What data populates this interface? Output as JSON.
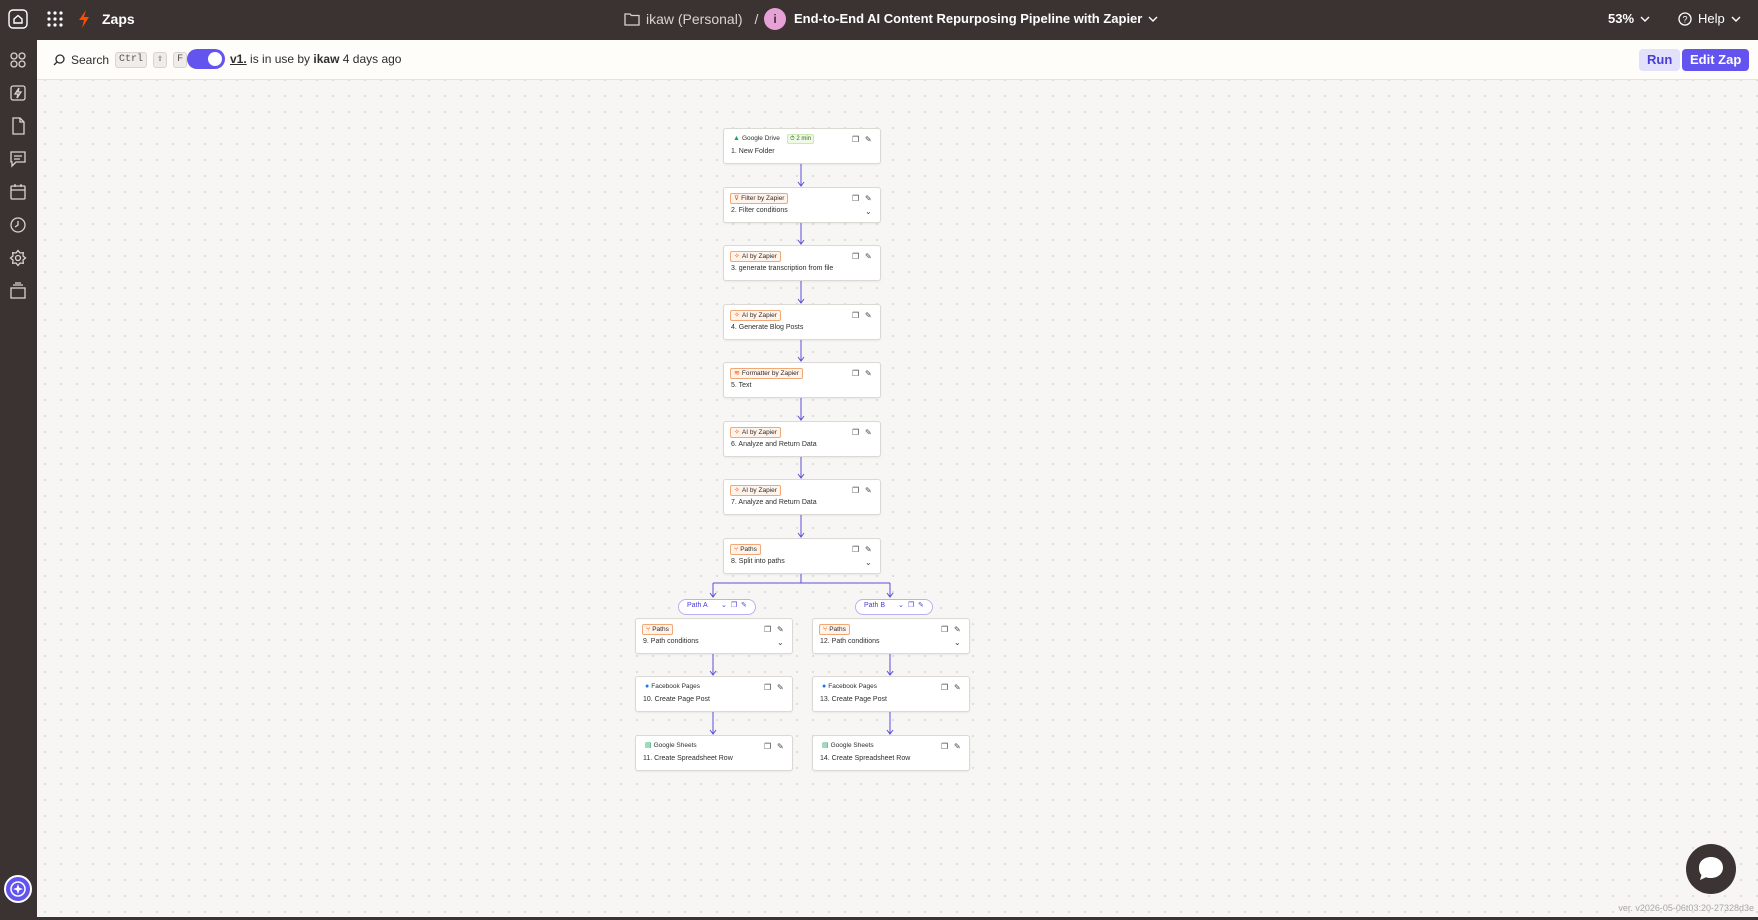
{
  "topbar": {
    "app_title": "Zaps",
    "folder": "ikaw (Personal)",
    "separator": "/",
    "avatar_letter": "i",
    "zap_name": "End-to-End AI Content Repurposing Pipeline with Zapier",
    "zoom": "53%",
    "help": "Help"
  },
  "sidebar": {
    "icons": [
      "apps-icon",
      "zaps-icon",
      "tables-icon",
      "interfaces-icon",
      "calendar-icon",
      "history-icon",
      "settings-icon",
      "archive-icon"
    ]
  },
  "subbar": {
    "search_label": "Search",
    "shortcut": [
      "Ctrl",
      "⇧",
      "F"
    ],
    "version_link": "v1.",
    "version_text_a": "is in use by",
    "version_user": "ikaw",
    "version_text_b": "4 days ago",
    "run_label": "Run",
    "edit_label": "Edit Zap"
  },
  "steps": [
    {
      "app": "Google Drive",
      "label": "1. New Folder",
      "time": "2 min",
      "utility": false
    },
    {
      "app": "Filter by Zapier",
      "label": "2. Filter conditions",
      "utility": true
    },
    {
      "app": "AI by Zapier",
      "label": "3. generate transcription from file",
      "utility": true
    },
    {
      "app": "AI by Zapier",
      "label": "4. Generate Blog Posts",
      "utility": true
    },
    {
      "app": "Formatter by Zapier",
      "label": "5. Text",
      "utility": true
    },
    {
      "app": "AI by Zapier",
      "label": "6. Analyze and Return Data",
      "utility": true
    },
    {
      "app": "AI by Zapier",
      "label": "7. Analyze and Return Data",
      "utility": true
    },
    {
      "app": "Paths",
      "label": "8. Split into paths",
      "utility": true
    },
    {
      "app": "Paths",
      "label": "9. Path conditions",
      "utility": true
    },
    {
      "app": "Facebook Pages",
      "label": "10. Create Page Post",
      "utility": false
    },
    {
      "app": "Google Sheets",
      "label": "11. Create Spreadsheet Row",
      "utility": false
    },
    {
      "app": "Paths",
      "label": "12. Path conditions",
      "utility": true
    },
    {
      "app": "Facebook Pages",
      "label": "13. Create Page Post",
      "utility": false
    },
    {
      "app": "Google Sheets",
      "label": "14. Create Spreadsheet Row",
      "utility": false
    }
  ],
  "paths": {
    "a": "Path A",
    "b": "Path B"
  },
  "footer_version": "ver. v2026-05-06t03:20-27328d3e",
  "colors": {
    "accent": "#6354f0",
    "topbar": "#3a3331",
    "utility_border": "#f0a877",
    "connector": "#5b4fd8"
  }
}
